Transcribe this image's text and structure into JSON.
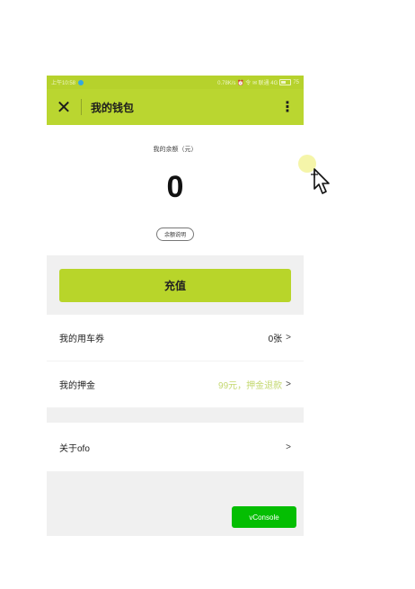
{
  "statusbar": {
    "time": "上午10:58",
    "network": "0.78K/s ⏰ 令 ✉ 联通 4G",
    "battery": "75"
  },
  "navbar": {
    "close_glyph": "✕",
    "title": "我的钱包",
    "more_glyph": "⋮"
  },
  "balance": {
    "label": "我的余额（元）",
    "amount": "0",
    "explain_label": "余额说明"
  },
  "recharge": {
    "label": "充值"
  },
  "rows": [
    {
      "label": "我的用车券",
      "value": "0张",
      "chevron": ">"
    },
    {
      "label": "我的押金",
      "value": "99元，押金退款",
      "chevron": ">"
    }
  ],
  "about": {
    "label": "关于ofo",
    "chevron": ">"
  },
  "vconsole": {
    "label": "vConsole"
  },
  "colors": {
    "accent": "#bad630",
    "vconsole": "#04be02"
  }
}
